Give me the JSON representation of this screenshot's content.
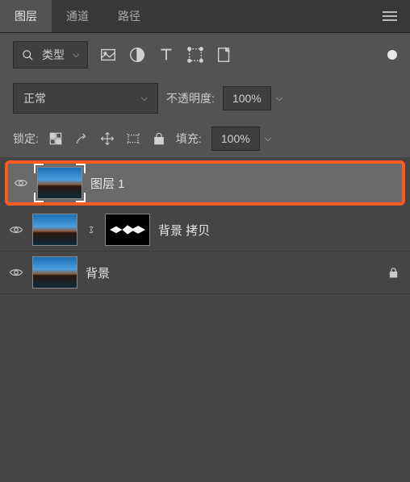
{
  "tabs": {
    "layers": "图层",
    "channels": "通道",
    "paths": "路径"
  },
  "filter": {
    "label": "类型"
  },
  "blend": {
    "mode": "正常",
    "opacity_label": "不透明度:",
    "opacity_value": "100%"
  },
  "lock": {
    "label": "锁定:",
    "fill_label": "填充:",
    "fill_value": "100%"
  },
  "layers": [
    {
      "name": "图层 1"
    },
    {
      "name": "背景 拷贝"
    },
    {
      "name": "背景"
    }
  ]
}
